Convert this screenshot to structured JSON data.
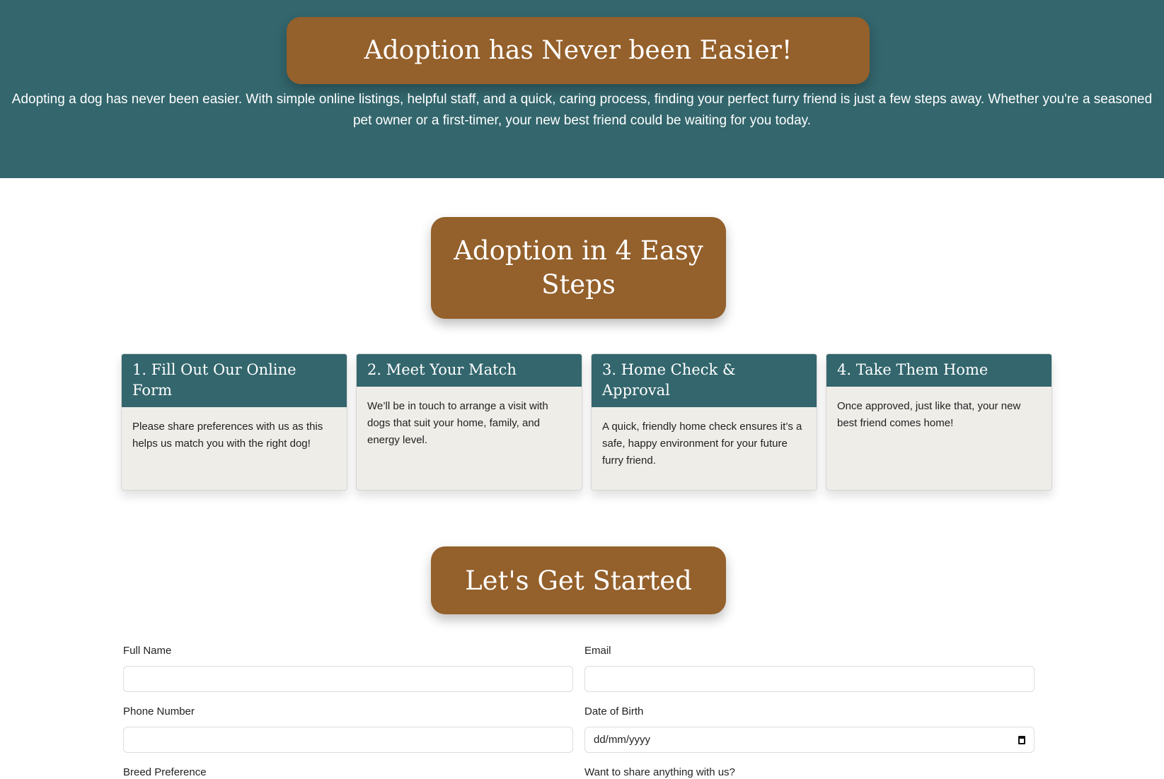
{
  "hero": {
    "title": "Adoption has Never been Easier!",
    "text": "Adopting a dog has never been easier. With simple online listings, helpful staff, and a quick, caring process, finding your perfect furry friend is just a few steps away. Whether you're a seasoned pet owner or a first-timer, your new best friend could be waiting for you today."
  },
  "steps": {
    "title": "Adoption in 4 Easy Steps",
    "cards": [
      {
        "title": "1. Fill Out Our Online Form",
        "text": "Please share preferences with us as this helps us match you with the right dog!"
      },
      {
        "title": "2. Meet Your Match",
        "text": "We’ll be in touch to arrange a visit with dogs that suit your home, family, and energy level."
      },
      {
        "title": "3. Home Check & Approval",
        "text": "A quick, friendly home check ensures it’s a safe, happy environment for your future furry friend."
      },
      {
        "title": "4. Take Them Home",
        "text": "Once approved, just like that, your new best friend comes home!"
      }
    ]
  },
  "form": {
    "title": "Let's Get Started",
    "full_name": "Full Name",
    "email": "Email",
    "phone": "Phone Number",
    "dob": "Date of Birth",
    "dob_placeholder": "dd/mm/yyyy",
    "breed": "Breed Preference",
    "share": "Want to share anything with us?"
  },
  "colors": {
    "teal": "#33666d",
    "brown": "#94602b",
    "card": "#efede8"
  },
  "icons": {
    "date_picker": "calendar-icon"
  }
}
